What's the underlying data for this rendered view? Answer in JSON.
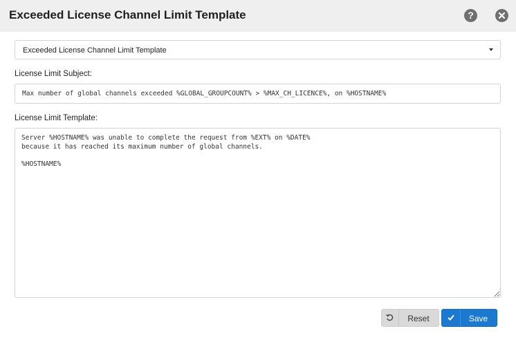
{
  "dialog": {
    "title": "Exceeded License Channel Limit Template",
    "help_icon": "question-circle-icon",
    "close_icon": "close-circle-icon"
  },
  "template_select": {
    "selected": "Exceeded License Channel Limit Template"
  },
  "subject": {
    "label": "License Limit Subject:",
    "value": "Max number of global channels exceeded %GLOBAL_GROUPCOUNT% > %MAX_CH_LICENCE%, on %HOSTNAME%"
  },
  "template": {
    "label": "License Limit Template:",
    "value": "Server %HOSTNAME% was unable to complete the request from %EXT% on %DATE%\nbecause it has reached its maximum number of global channels.\n\n%HOSTNAME%"
  },
  "buttons": {
    "reset_label": "Reset",
    "reset_icon": "undo-icon",
    "save_label": "Save",
    "save_icon": "check-icon"
  },
  "colors": {
    "header_bg": "#efefef",
    "save_bg": "#1b7ad0",
    "reset_bg": "#d9d9d9",
    "icon_gray": "#6f6f6f"
  }
}
